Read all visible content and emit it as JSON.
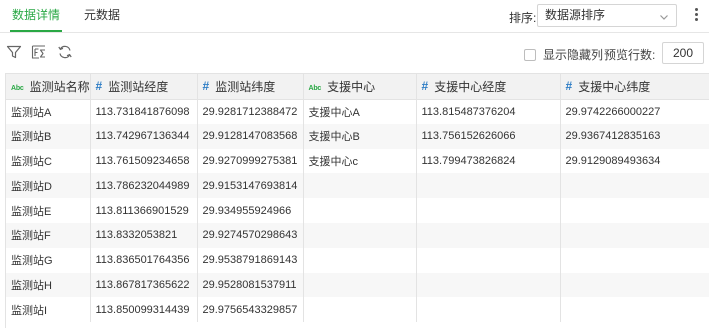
{
  "tabs": [
    {
      "label": "数据详情",
      "active": true
    },
    {
      "label": "元数据",
      "active": false
    }
  ],
  "sort": {
    "label": "排序:",
    "value": "数据源排序"
  },
  "toolbar": {
    "icons": [
      "filter-icon",
      "sum-function-icon",
      "refresh-icon"
    ],
    "show_hidden_label": "显示隐藏列",
    "show_hidden_checked": false,
    "preview_rows_label": "预览行数:",
    "preview_rows_value": "200"
  },
  "colors": {
    "accent": "#2aa845",
    "number_type": "#2e7dc5"
  },
  "table": {
    "columns": [
      {
        "type": "Abc",
        "label": "监测站名称"
      },
      {
        "type": "#",
        "label": "监测站经度"
      },
      {
        "type": "#",
        "label": "监测站纬度"
      },
      {
        "type": "Abc",
        "label": "支援中心"
      },
      {
        "type": "#",
        "label": "支援中心经度"
      },
      {
        "type": "#",
        "label": "支援中心纬度"
      }
    ],
    "rows": [
      [
        "监测站A",
        "113.731841876098",
        "29.9281712388472",
        "支援中心A",
        "113.815487376204",
        "29.9742266000227"
      ],
      [
        "监测站B",
        "113.742967136344",
        "29.9128147083568",
        "支援中心B",
        "113.756152626066",
        "29.9367412835163"
      ],
      [
        "监测站C",
        "113.761509234658",
        "29.9270999275381",
        "支援中心c",
        "113.799473826824",
        "29.9129089493634"
      ],
      [
        "监测站D",
        "113.786232044989",
        "29.9153147693814",
        "",
        "",
        ""
      ],
      [
        "监测站E",
        "113.811366901529",
        "29.934955924966",
        "",
        "",
        ""
      ],
      [
        "监测站F",
        "113.8332053821",
        "29.9274570298643",
        "",
        "",
        ""
      ],
      [
        "监测站G",
        "113.836501764356",
        "29.9538791869143",
        "",
        "",
        ""
      ],
      [
        "监测站H",
        "113.867817365622",
        "29.9528081537911",
        "",
        "",
        ""
      ],
      [
        "监测站I",
        "113.850099314439",
        "29.9756543329857",
        "",
        "",
        ""
      ]
    ]
  }
}
